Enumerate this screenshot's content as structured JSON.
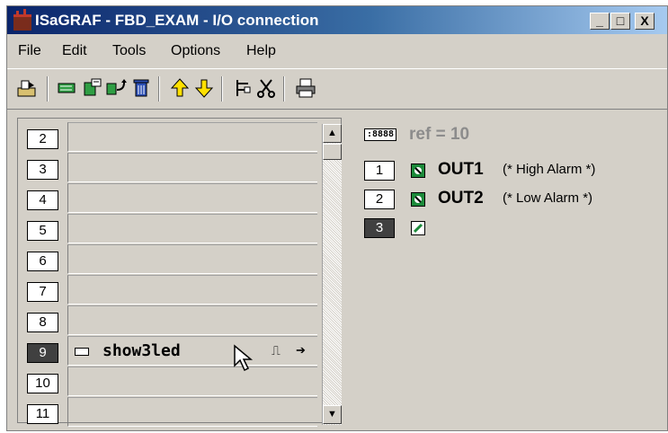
{
  "window": {
    "title": "ISaGRAF - FBD_EXAM - I/O connection",
    "minimize_label": "_",
    "maximize_label": "□",
    "close_label": "X"
  },
  "menu": [
    "File",
    "Edit",
    "Tools",
    "Options",
    "Help"
  ],
  "toolbar": {
    "icons": [
      "open-icon",
      "connect-icon",
      "disconnect-icon",
      "refresh-icon",
      "delete-icon",
      "move-up-icon",
      "move-down-icon",
      "tree-icon",
      "cut-icon",
      "print-icon"
    ]
  },
  "boards": {
    "rows": [
      {
        "num": "2",
        "var": ""
      },
      {
        "num": "3",
        "var": ""
      },
      {
        "num": "4",
        "var": ""
      },
      {
        "num": "5",
        "var": ""
      },
      {
        "num": "6",
        "var": ""
      },
      {
        "num": "7",
        "var": ""
      },
      {
        "num": "8",
        "var": ""
      },
      {
        "num": "9",
        "var": "show3led",
        "selected": true
      },
      {
        "num": "10",
        "var": ""
      },
      {
        "num": "11",
        "var": ""
      }
    ]
  },
  "scroll": {
    "up_label": "▲",
    "down_label": "▼"
  },
  "io": {
    "ref_icon_text": ":8888",
    "ref_text": "ref = 10",
    "channels": [
      {
        "num": "1",
        "name": "OUT1",
        "comment": "(* High Alarm *)"
      },
      {
        "num": "2",
        "name": "OUT2",
        "comment": "(* Low Alarm *)"
      },
      {
        "num": "3",
        "name": "",
        "comment": "",
        "selected": true
      }
    ]
  },
  "colors": {
    "title_gradient_start": "#0a246a",
    "title_gradient_end": "#a6caf0",
    "window_bg": "#d4d0c8",
    "selected_num_bg": "#404040",
    "ref_text": "#8c8c8c",
    "io_icon_green": "#1c8a3a"
  }
}
